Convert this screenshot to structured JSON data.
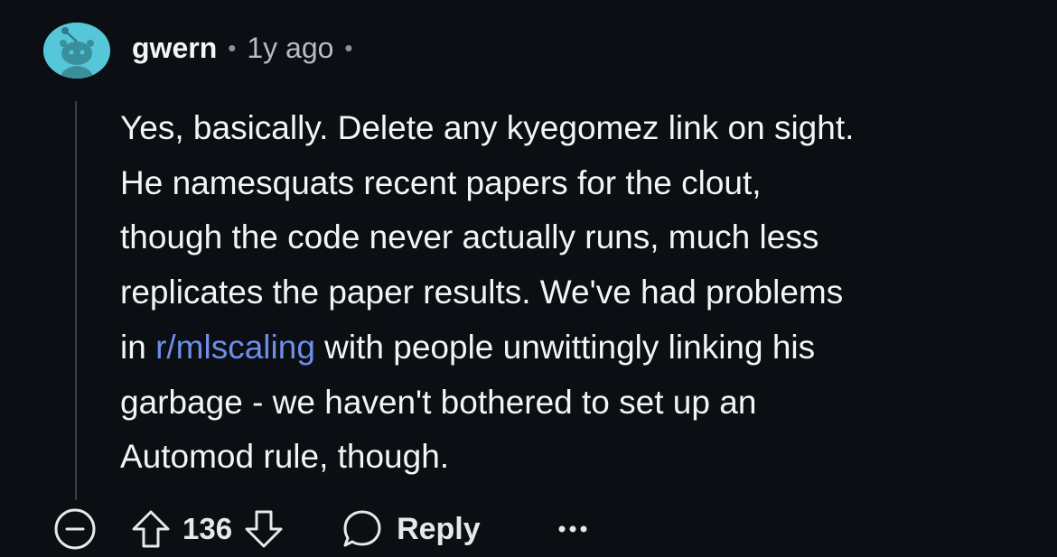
{
  "comment": {
    "username": "gwern",
    "separator": "•",
    "time": "1y ago",
    "trailing_separator": "•",
    "body": {
      "line1": "Yes, basically. Delete any kyegomez link on sight.",
      "line2": "He namesquats recent papers for the clout,",
      "line3": "though the code never actually runs, much less",
      "line4": "replicates the paper results. We've had problems",
      "line5_prefix": "in ",
      "line5_link": "r/mlscaling",
      "line5_suffix": " with people unwittingly linking his",
      "line6": "garbage - we haven't bothered to set up an",
      "line7": "Automod rule, though."
    }
  },
  "actions": {
    "collapse_icon": "minus-circle-icon",
    "upvote_icon": "arrow-up-icon",
    "vote_count": "136",
    "downvote_icon": "arrow-down-icon",
    "reply_icon": "speech-bubble-icon",
    "reply_label": "Reply",
    "more_icon": "ellipsis-icon"
  },
  "colors": {
    "background": "#0b0e12",
    "text": "#f2f4f5",
    "link": "#6e8ee8",
    "avatar": "#56c7d8",
    "muted": "#b6bdc2"
  }
}
